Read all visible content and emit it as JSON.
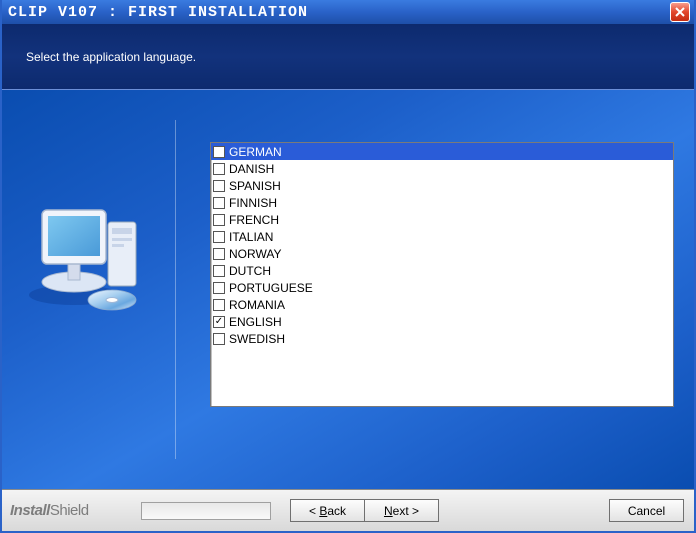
{
  "window": {
    "title": "CLIP V107 : FIRST INSTALLATION"
  },
  "header": {
    "prompt": "Select the application language."
  },
  "languages": [
    {
      "label": "GERMAN",
      "checked": false,
      "highlighted": true
    },
    {
      "label": "DANISH",
      "checked": false,
      "highlighted": false
    },
    {
      "label": "SPANISH",
      "checked": false,
      "highlighted": false
    },
    {
      "label": "FINNISH",
      "checked": false,
      "highlighted": false
    },
    {
      "label": "FRENCH",
      "checked": false,
      "highlighted": false
    },
    {
      "label": "ITALIAN",
      "checked": false,
      "highlighted": false
    },
    {
      "label": "NORWAY",
      "checked": false,
      "highlighted": false
    },
    {
      "label": "DUTCH",
      "checked": false,
      "highlighted": false
    },
    {
      "label": "PORTUGUESE",
      "checked": false,
      "highlighted": false
    },
    {
      "label": "ROMANIA",
      "checked": false,
      "highlighted": false
    },
    {
      "label": "ENGLISH",
      "checked": true,
      "highlighted": false
    },
    {
      "label": "SWEDISH",
      "checked": false,
      "highlighted": false
    }
  ],
  "footer": {
    "brand_bold": "Install",
    "brand_light": "Shield",
    "back_prefix": "< ",
    "back_mnemonic": "B",
    "back_rest": "ack",
    "next_mnemonic": "N",
    "next_rest": "ext >",
    "cancel": "Cancel"
  }
}
